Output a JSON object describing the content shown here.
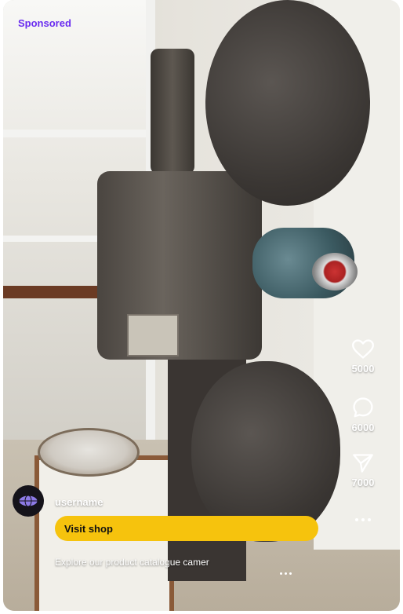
{
  "header": {
    "sponsored_label": "Sponsored"
  },
  "actions": {
    "like": {
      "icon": "heart-icon",
      "count": "5000"
    },
    "comment": {
      "icon": "comment-bubble-icon",
      "count": "6000"
    },
    "share": {
      "icon": "send-icon",
      "count": "7000"
    },
    "more": {
      "icon": "more-dots-icon"
    }
  },
  "post": {
    "username": "username",
    "avatar_icon": "globe-avatar-icon",
    "cta_label": "Visit shop",
    "caption": "Explore our product catalogue  camer",
    "caption_more_icon": "ellipsis-icon"
  },
  "colors": {
    "sponsored": "#6a2cf0",
    "cta_background": "#f6c30d",
    "overlay_text": "#ffffff"
  }
}
